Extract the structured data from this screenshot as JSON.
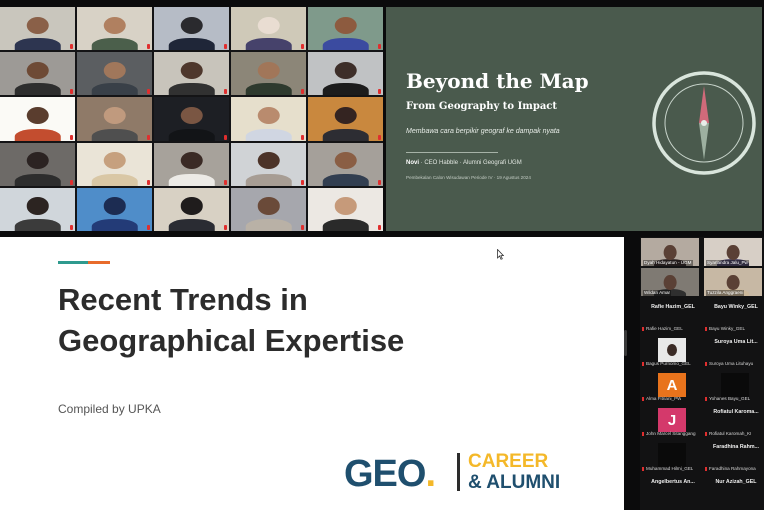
{
  "gallery": {
    "tiles": [
      {
        "name": "",
        "bg": "#c9c6bd",
        "skin": "#8a6048",
        "shirt": "#2d3550"
      },
      {
        "name": "",
        "bg": "#d8d2c6",
        "skin": "#b08060",
        "shirt": "#4b5f4b"
      },
      {
        "name": "",
        "bg": "#b6bcc6",
        "skin": "#2a2a2e",
        "shirt": "#1f2638"
      },
      {
        "name": "",
        "bg": "#cfc9b8",
        "skin": "#e9ddd2",
        "shirt": "#46426b"
      },
      {
        "name": "",
        "bg": "#7f9a8b",
        "skin": "#8d5b3f",
        "shirt": "#3b4ba0"
      },
      {
        "name": "",
        "bg": "#9d9a96",
        "skin": "#6e4a35",
        "shirt": "#2e2e2e"
      },
      {
        "name": "",
        "bg": "#5b5e61",
        "skin": "#a0775b",
        "shirt": "#394048"
      },
      {
        "name": "",
        "bg": "#c8c4bb",
        "skin": "#4e372c",
        "shirt": "#313131"
      },
      {
        "name": "",
        "bg": "#8c8678",
        "skin": "#a17659",
        "shirt": "#2e3a2e"
      },
      {
        "name": "",
        "bg": "#c0c2c4",
        "skin": "#3d2e29",
        "shirt": "#1c1c1c"
      },
      {
        "name": "",
        "bg": "#fbfaf6",
        "skin": "#5a3d2e",
        "shirt": "#c34d2f"
      },
      {
        "name": "",
        "bg": "#8f7a68",
        "skin": "#c09a7e",
        "shirt": "#4f4f4f"
      },
      {
        "name": "",
        "bg": "#1d1f24",
        "skin": "#7a5643",
        "shirt": "#121417"
      },
      {
        "name": "",
        "bg": "#e6dfcc",
        "skin": "#b98b6e",
        "shirt": "#d0d6e2"
      },
      {
        "name": "",
        "bg": "#c9883e",
        "skin": "#342421",
        "shirt": "#2d2d33"
      },
      {
        "name": "",
        "bg": "#6d6a67",
        "skin": "#2b2322",
        "shirt": "#2d2d2d"
      },
      {
        "name": "",
        "bg": "#eae4d7",
        "skin": "#c6a07e",
        "shirt": "#d9c7a5"
      },
      {
        "name": "",
        "bg": "#a7a29b",
        "skin": "#3a2a25",
        "shirt": "#eceae6"
      },
      {
        "name": "",
        "bg": "#d0d3d6",
        "skin": "#4c3328",
        "shirt": "#a79d94"
      },
      {
        "name": "",
        "bg": "#a5a09a",
        "skin": "#8a5e44",
        "shirt": "#323e50"
      },
      {
        "name": "",
        "bg": "#d0d6db",
        "skin": "#2c2421",
        "shirt": "#3b3b3b"
      },
      {
        "name": "",
        "bg": "#4f8dc9",
        "skin": "#1c2c52",
        "shirt": "#233b77"
      },
      {
        "name": "",
        "bg": "#d8d1c4",
        "skin": "#1f1c1c",
        "shirt": "#2a2c33"
      },
      {
        "name": "",
        "bg": "#a6a7ad",
        "skin": "#6a4a39",
        "shirt": "#b9b1a6"
      },
      {
        "name": "",
        "bg": "#ece8e3",
        "skin": "#c69a7a",
        "shirt": "#2a2a2a"
      }
    ]
  },
  "slide_top": {
    "title": "Beyond the Map",
    "subtitle": "From Geography to Impact",
    "tagline": "Membawa cara berpikir geograf ke dampak nyata",
    "speaker_name": "Novi",
    "speaker_role": " · CEO Habble · Alumni Geografi UGM",
    "event": "Pembekalan Calon Wisudawan Periode IV · 19 Agustus 2024",
    "bg_color": "#4a5a4d"
  },
  "slide_main": {
    "title_line1": "Recent Trends in",
    "title_line2": "Geographical Expertise",
    "compiled_by": "Compiled by UPKA",
    "logo_geo": "GEO",
    "logo_dot": ".",
    "logo_career": "CAREER",
    "logo_alumni": "& ALUMNI",
    "accent_teal": "#2f9a8e",
    "accent_orange": "#e86b2b"
  },
  "panel": {
    "videos": [
      {
        "name": "Dyah Hidayatun - UGM",
        "bg": "#b4aaa0",
        "shirt": "#3b3030"
      },
      {
        "name": "Syarlandra Jalu_Pw",
        "bg": "#d7cfc6",
        "shirt": "#514a6a"
      },
      {
        "name": "Wildan Amar",
        "bg": "#7f7a73",
        "shirt": "#2f2f2f"
      },
      {
        "name": "Tuzzila Anggraeni",
        "bg": "#c7b8a4",
        "shirt": "#ccb89a"
      }
    ],
    "cells": [
      {
        "big": "Rafie Hazim_GEL",
        "small": "Rafie Hazim_GEL",
        "av": "",
        "av_color": ""
      },
      {
        "big": "Bayu Winky_GEL",
        "small": "Bayu Winky_GEL",
        "av": "",
        "av_color": ""
      },
      {
        "big": "",
        "small": "Bagus Purnomo_GEL",
        "av": "",
        "av_color": "photo"
      },
      {
        "big": "Suroya Uma Lit...",
        "small": "Suroya Uma Lituhayu",
        "av": "",
        "av_color": ""
      },
      {
        "big": "",
        "small": "Alma Fitriani_PW",
        "av": "A",
        "av_color": "#e8731c"
      },
      {
        "big": "",
        "small": "Yohanes Bayu_GEL",
        "av": "",
        "av_color": "#0a0a0a"
      },
      {
        "big": "",
        "small": "John Marcel Sitanggang",
        "av": "J",
        "av_color": "#d4396b"
      },
      {
        "big": "Rofiatul Karoma...",
        "small": "Rofiatul Karomah_KI",
        "av": "",
        "av_color": ""
      },
      {
        "big": "",
        "small": "Muhammad Hilmi_GEL",
        "av": "",
        "av_color": "#0a0a0a"
      },
      {
        "big": "Faradhina Rahm...",
        "small": "Faradhina Rahmayona",
        "av": "",
        "av_color": ""
      },
      {
        "big": "Angelbertus An...",
        "small": "",
        "av": "",
        "av_color": ""
      },
      {
        "big": "Nur Azizah_GEL",
        "small": "",
        "av": "",
        "av_color": ""
      }
    ]
  }
}
